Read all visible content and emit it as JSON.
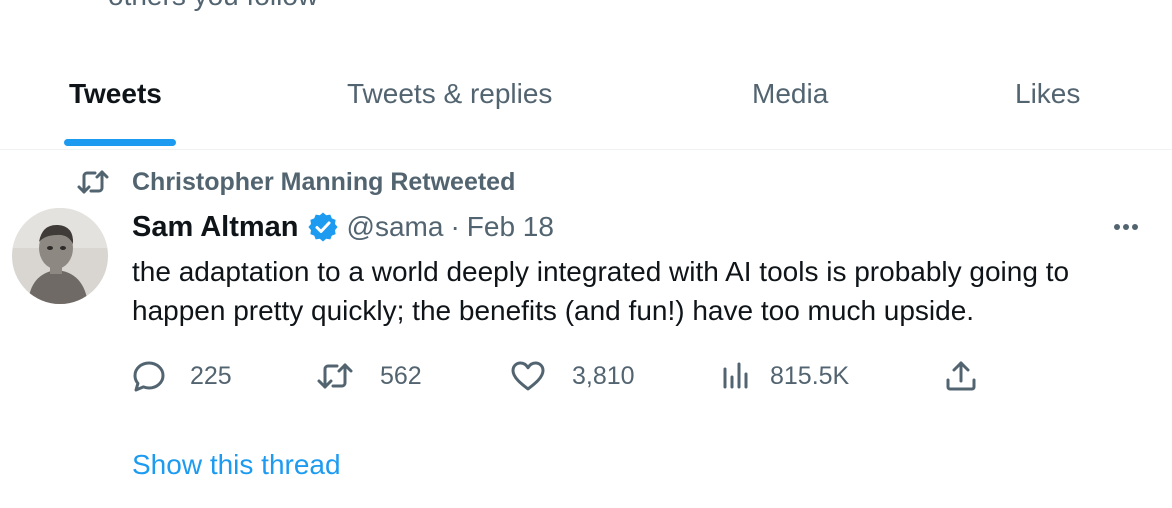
{
  "header_cut_text": "others you follow",
  "tabs": [
    {
      "label": "Tweets",
      "active": true
    },
    {
      "label": "Tweets & replies",
      "active": false
    },
    {
      "label": "Media",
      "active": false
    },
    {
      "label": "Likes",
      "active": false
    }
  ],
  "tweet": {
    "social_context": "Christopher Manning Retweeted",
    "author_name": "Sam Altman",
    "verified": true,
    "handle": "@sama",
    "separator": "·",
    "date": "Feb 18",
    "text": "the adaptation to a world deeply integrated with AI tools is probably going to happen pretty quickly; the benefits (and fun!) have too much upside.",
    "stats": {
      "replies": "225",
      "retweets": "562",
      "likes": "3,810",
      "views": "815.5K"
    },
    "show_thread_label": "Show this thread"
  },
  "icons": {
    "retweet": "retweet-icon",
    "verified": "verified-badge-icon",
    "more": "more-icon",
    "reply": "reply-icon",
    "like": "heart-icon",
    "views": "views-icon",
    "share": "share-icon"
  },
  "colors": {
    "accent": "#1d9bf0",
    "secondary_text": "#536471",
    "primary_text": "#0f1419"
  }
}
